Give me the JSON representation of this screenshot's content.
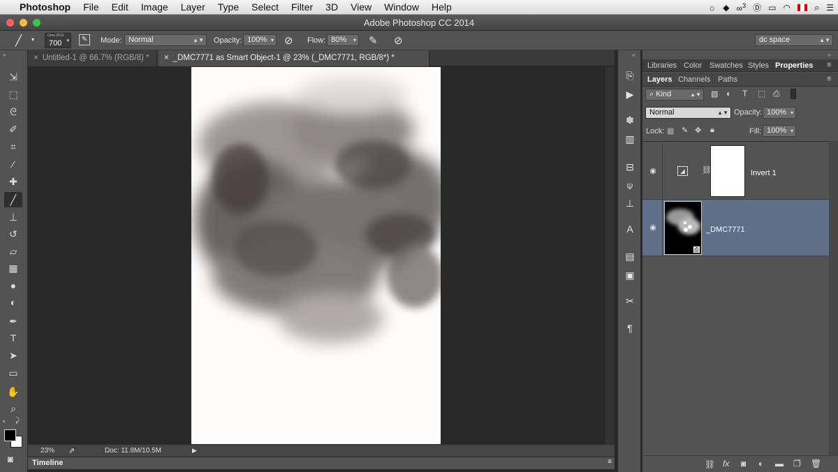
{
  "menubar": {
    "apple": "",
    "items": [
      "Photoshop",
      "File",
      "Edit",
      "Image",
      "Layer",
      "Type",
      "Select",
      "Filter",
      "3D",
      "View",
      "Window",
      "Help"
    ],
    "status_badge": "3"
  },
  "window": {
    "title": "Adobe Photoshop CC 2014"
  },
  "options": {
    "brush_size_label": "Oma 2015",
    "brush_size": "700",
    "mode_label": "Mode:",
    "mode_value": "Normal",
    "opacity_label": "Opacity:",
    "opacity_value": "100%",
    "flow_label": "Flow:",
    "flow_value": "80%",
    "workspace": "dc space"
  },
  "tabs": [
    {
      "label": "Untitled-1 @ 66.7% (RGB/8) *"
    },
    {
      "label": "_DMC7771 as Smart Object-1 @ 23% (_DMC7771, RGB/8*) *"
    }
  ],
  "status": {
    "zoom": "23%",
    "doc": "Doc: 11.8M/10.5M"
  },
  "timeline": {
    "label": "Timeline"
  },
  "panel": {
    "top_tabs": [
      "Libraries",
      "Color",
      "Swatches",
      "Styles",
      "Properties"
    ],
    "layer_tabs": [
      "Layers",
      "Channels",
      "Paths"
    ],
    "kind_label": "Kind",
    "blend_mode": "Normal",
    "opacity_label": "Opacity:",
    "opacity_value": "100%",
    "lock_label": "Lock:",
    "fill_label": "Fill:",
    "fill_value": "100%",
    "layers": [
      {
        "name": "Invert 1"
      },
      {
        "name": "_DMC7771"
      }
    ]
  },
  "colors": {
    "selected_layer": "#5f6f87",
    "panel_bg": "#535353",
    "canvas_bg": "#282828"
  }
}
